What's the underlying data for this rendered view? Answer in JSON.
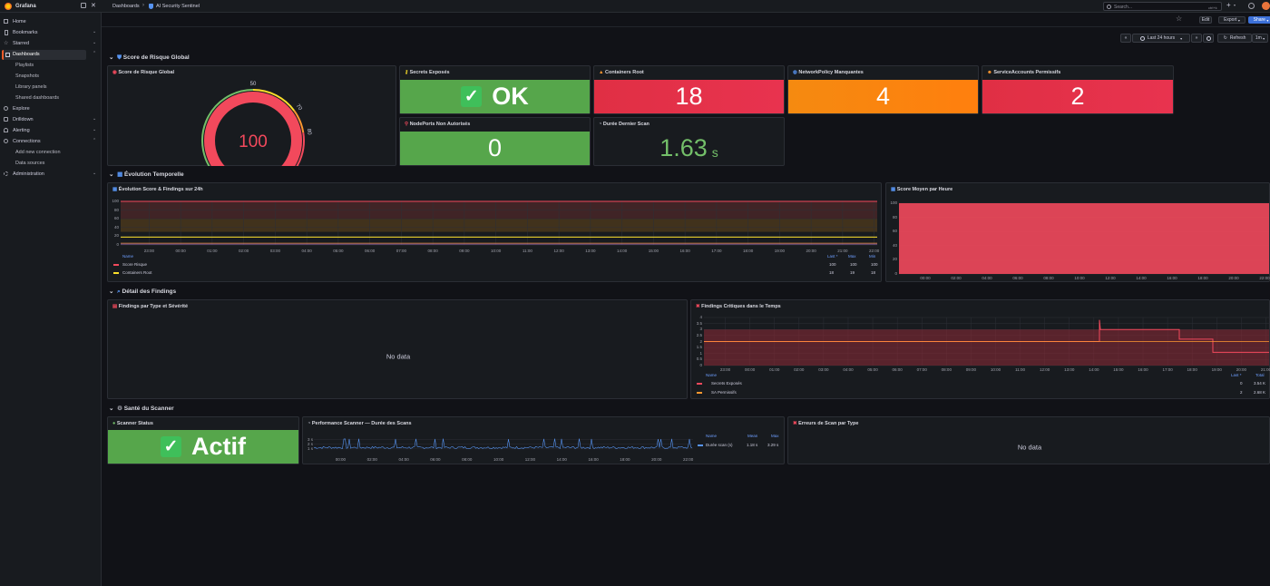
{
  "topbar": {
    "app_name": "Grafana",
    "crumb_root": "Dashboards",
    "crumb_sep": "›",
    "crumb_current": "AI Security Sentinel",
    "search_placeholder": "Search...",
    "search_shortcut": "ctrl+k"
  },
  "toolbar": {
    "edit": "Edit",
    "export": "Export",
    "share": "Share",
    "time_range": "Last 24 hours",
    "refresh": "Refresh",
    "interval": "1m"
  },
  "nav": {
    "home": "Home",
    "bookmarks": "Bookmarks",
    "starred": "Starred",
    "dashboards": "Dashboards",
    "playlists": "Playlists",
    "snapshots": "Snapshots",
    "library": "Library panels",
    "shared": "Shared dashboards",
    "explore": "Explore",
    "drilldown": "Drilldown",
    "alerting": "Alerting",
    "connections": "Connections",
    "add_conn": "Add new connection",
    "datasources": "Data sources",
    "admin": "Administration"
  },
  "rows": {
    "r1": "Score de Risque Global",
    "r2": "Évolution Temporelle",
    "r3": "Détail des Findings",
    "r4": "Santé du Scanner"
  },
  "panels": {
    "gauge": {
      "title": "Score de Risque Global",
      "value": "100",
      "value_num": 100,
      "min": 0,
      "max": 100,
      "ticks": [
        "0",
        "50",
        "70",
        "80",
        "100"
      ]
    },
    "secrets": {
      "title": "Secrets Exposés",
      "value": "OK"
    },
    "containers": {
      "title": "Containers Root",
      "value": "18"
    },
    "netpol": {
      "title": "NetworkPolicy Manquantes",
      "value": "4"
    },
    "sa": {
      "title": "ServiceAccounts Permissifs",
      "value": "2"
    },
    "nodeports": {
      "title": "NodePorts Non Autorisés",
      "value": "0"
    },
    "duration": {
      "title": "Durée Dernier Scan",
      "value": "1.63",
      "unit": "s"
    },
    "evo": {
      "title": "Évolution Score & Findings sur 24h",
      "y_ticks": [
        "100",
        "80",
        "60",
        "40",
        "20",
        "0"
      ],
      "x_ticks": [
        "23:00",
        "00:00",
        "01:00",
        "02:00",
        "03:00",
        "04:00",
        "05:00",
        "06:00",
        "07:00",
        "08:00",
        "09:00",
        "10:00",
        "11:00",
        "12:00",
        "13:00",
        "14:00",
        "15:00",
        "16:00",
        "17:00",
        "18:00",
        "19:00",
        "20:00",
        "21:00",
        "22:00"
      ],
      "leg_cols": [
        "Name",
        "Last *",
        "Max",
        "Min"
      ],
      "legend": [
        {
          "name": "Score Risque",
          "last": "100",
          "max": "100",
          "min": "100",
          "color": "#f2495c"
        },
        {
          "name": "Containers Root",
          "last": "18",
          "max": "19",
          "min": "18",
          "color": "#fade2a"
        }
      ]
    },
    "avg": {
      "title": "Score Moyen par Heure",
      "y_ticks": [
        "100",
        "80",
        "60",
        "40",
        "20",
        "0"
      ],
      "x_ticks": [
        "00:00",
        "02:00",
        "04:00",
        "06:00",
        "08:00",
        "10:00",
        "12:00",
        "14:00",
        "16:00",
        "18:00",
        "20:00",
        "22:00"
      ]
    },
    "ftype": {
      "title": "Findings par Type et Sévérité",
      "nodata": "No data"
    },
    "fcrit": {
      "title": "Findings Critiques dans le Temps",
      "y_ticks": [
        "4",
        "3.5",
        "3",
        "2.5",
        "2",
        "1.5",
        "1",
        "0.5",
        "0"
      ],
      "x_ticks": [
        "23:00",
        "00:00",
        "01:00",
        "02:00",
        "03:00",
        "04:00",
        "05:00",
        "06:00",
        "07:00",
        "08:00",
        "09:00",
        "10:00",
        "11:00",
        "12:00",
        "13:00",
        "14:00",
        "15:00",
        "16:00",
        "17:00",
        "18:00",
        "19:00",
        "20:00",
        "21:00"
      ],
      "leg_cols": [
        "Name",
        "Last *",
        "Total"
      ],
      "legend": [
        {
          "name": "Secrets Exposés",
          "last": "0",
          "total": "3.54 K",
          "color": "#f2495c"
        },
        {
          "name": "SA Permissifs",
          "last": "2",
          "total": "2.68 K",
          "color": "#ff9830"
        }
      ]
    },
    "status": {
      "title": "Scanner Status",
      "value": "Actif"
    },
    "perf": {
      "title": "Performance Scanner — Durée des Scans",
      "y_ticks": [
        "3 s",
        "2 s",
        "1 s"
      ],
      "x_ticks": [
        "00:00",
        "02:00",
        "04:00",
        "06:00",
        "08:00",
        "10:00",
        "12:00",
        "14:00",
        "16:00",
        "18:00",
        "20:00",
        "22:00"
      ],
      "leg_cols": [
        "Name",
        "Mean",
        "Max"
      ],
      "legend": [
        {
          "name": "Durée scan (s)",
          "mean": "1.18 s",
          "max": "3.29 s",
          "color": "#5794f2"
        }
      ]
    },
    "errors": {
      "title": "Erreurs de Scan par Type",
      "nodata": "No data"
    }
  },
  "colors": {
    "green": "#56a64b",
    "red": "#e02f44",
    "orange": "#ff7f0e",
    "series_red": "#f2495c",
    "blue": "#5794f2",
    "accent": "#3d71d9"
  }
}
